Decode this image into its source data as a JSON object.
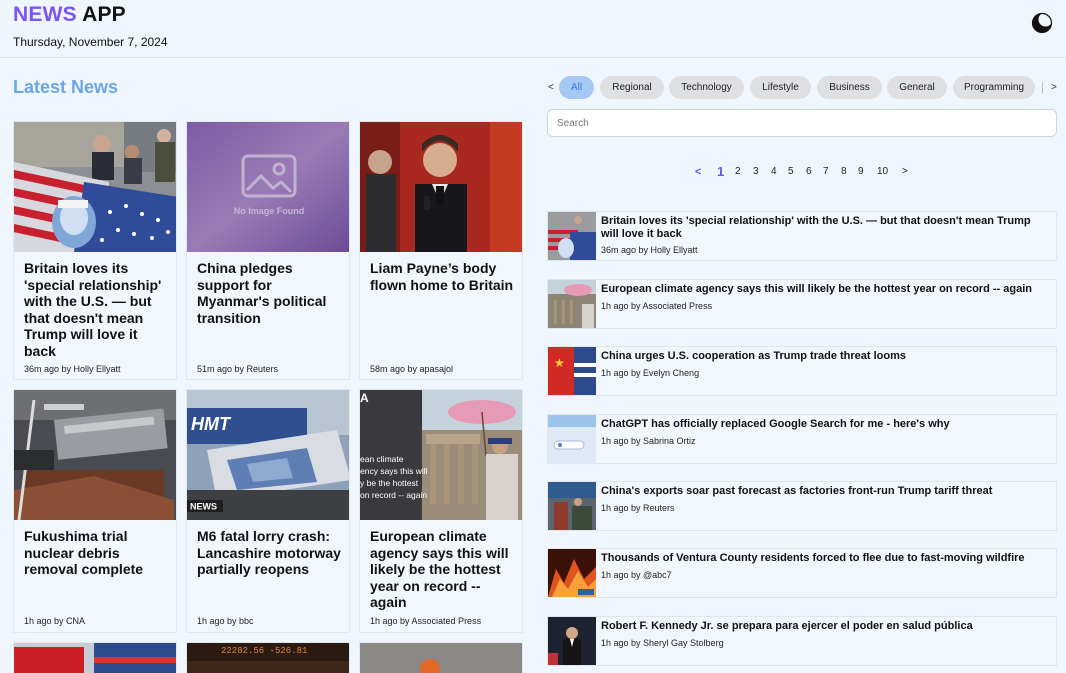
{
  "header": {
    "brand_accent": "NEWS",
    "brand_rest": "APP",
    "date": "Thursday, November 7, 2024",
    "theme_icon": "moon-icon",
    "accent_color": "#7b54f5"
  },
  "latest": {
    "title": "Latest News",
    "cards": [
      {
        "title": "Britain loves its 'special relationship' with the U.S. — but that doesn't mean Trump will love it back",
        "meta": "36m ago by Holly Ellyatt",
        "image": "flag-portrait"
      },
      {
        "title": "China pledges support for Myanmar's political transition",
        "meta": "51m ago by Reuters",
        "image": "no-image"
      },
      {
        "title": "Liam Payne’s body flown home to Britain",
        "meta": "58m ago by apasajol",
        "image": "singer-stage"
      },
      {
        "title": "Fukushima trial nuclear debris removal complete",
        "meta": "1h ago by CNA",
        "image": "debris-machine"
      },
      {
        "title": "M6 fatal lorry crash: Lancashire motorway partially reopens",
        "meta": "1h ago by bbc",
        "image": "lorry-crash"
      },
      {
        "title": "European climate agency says this will likely be the hottest year on record -- again",
        "meta": "1h ago by Associated Press",
        "image": "parasol-ruins"
      }
    ],
    "no_image_label": "No Image Found",
    "news_badge": "NEWS",
    "overlay_caption": [
      "ean climate",
      "ency says this will",
      "y be the hottest",
      "on record -- again"
    ],
    "ticker_text": "22282.56  -526.81"
  },
  "categories": {
    "prev": "<",
    "next": ">",
    "items": [
      "All",
      "Regional",
      "Technology",
      "Lifestyle",
      "Business",
      "General",
      "Programming"
    ],
    "active": "All"
  },
  "search": {
    "placeholder": "Search"
  },
  "pagination": {
    "prev": "<",
    "next": ">",
    "pages": [
      "1",
      "2",
      "3",
      "4",
      "5",
      "6",
      "7",
      "8",
      "9",
      "10"
    ],
    "current": "1"
  },
  "list": [
    {
      "title": "Britain loves its 'special relationship' with the U.S. — but that doesn't mean Trump will love it back",
      "meta": "36m ago by Holly Ellyatt"
    },
    {
      "title": "European climate agency says this will likely be the hottest year on record -- again",
      "meta": "1h ago by Associated Press"
    },
    {
      "title": "China urges U.S. cooperation as Trump trade threat looms",
      "meta": "1h ago by Evelyn Cheng"
    },
    {
      "title": "ChatGPT has officially replaced Google Search for me - here's why",
      "meta": "1h ago by Sabrina Ortiz"
    },
    {
      "title": "China's exports soar past forecast as factories front-run Trump tariff threat",
      "meta": "1h ago by Reuters"
    },
    {
      "title": "Thousands of Ventura County residents forced to flee due to fast-moving wildfire",
      "meta": "1h ago by @abc7"
    },
    {
      "title": "Robert F. Kennedy Jr. se prepara para ejercer el poder en salud pública",
      "meta": "1h ago by Sheryl Gay Stolberg"
    }
  ]
}
